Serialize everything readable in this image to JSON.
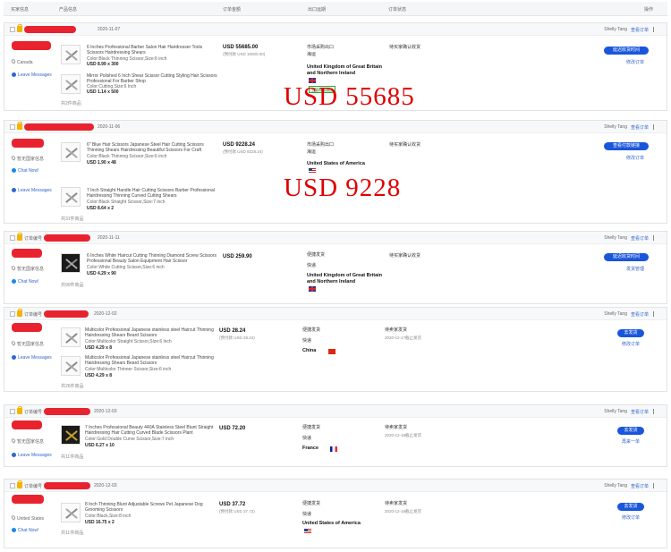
{
  "header": {
    "buyer": "买家信息",
    "product": "产品信息",
    "amount": "订单金额",
    "ship_date": "出口运期",
    "status": "订单状态",
    "action": "操作"
  },
  "orders": [
    {
      "date": "2020-11-07",
      "staff": "Shelly Tang",
      "remark": "查看订单",
      "country": "Canada",
      "message": "Leave Messages",
      "items": [
        {
          "title": "6 Inches Professional Barber Salon Hair Hairdresser Tools Scissors Hairdressing Shears",
          "meta": "Color:Black Thinning Scissor,Size:6 inch",
          "price": "USD 8.99 x 300"
        },
        {
          "title": "Mirror Polished 6 Inch Shear Scissor Cutting Styling Hair Scissors Professional For Barber Shop",
          "meta": "Color:Cutting,Size:6 Inch",
          "price": "USD 1.14 x 500"
        }
      ],
      "count": "共2件商品",
      "amount": "USD 55685.00",
      "amount_sub": "(预付款 USD 10000.00)",
      "shipping": [
        "市场采购出口",
        "海运"
      ],
      "destination": "United Kingdom of Great Britain and Northern Ireland",
      "flag": "uk",
      "status": "待买家确认收货",
      "button": "延迟收货时间",
      "link": "修改订单"
    },
    {
      "date": "2020-11-06",
      "staff": "Shelly Tang",
      "remark": "查看订单",
      "country": "暂无国家信息",
      "message": "Leave Messages",
      "chat": "Chat Now!",
      "items": [
        {
          "title": "6\" Blue Hair Scissors Japanese Steel Hair Cutting Scissors Thinning Shears Hairdressing Beautiful Scissors For Craft",
          "meta": "Color:Black Thinning Scissor,Size:6 inch",
          "price": "USD 1.90 x 48"
        },
        {
          "title": "7 Inch Straight Handle Hair Cutting Scissors Barber Professional Hairdressing Thinning Curved Cutting Shears",
          "meta": "Color:Black Straight Scissor,Size:7 inch",
          "price": "USD 8.64 x 2"
        }
      ],
      "count": "共31件商品",
      "amount": "USD 9228.24",
      "amount_sub": "(预付款 USD 9228.24)",
      "shipping": [
        "市场采购出口",
        "海运"
      ],
      "destination": "United States of America",
      "flag": "us",
      "status": "待买家确认收货",
      "button": "查看付款链接",
      "link": "修改订单"
    },
    {
      "label": "订单编号",
      "date": "2020-11-11",
      "staff": "Shelly Tang",
      "remark": "查看订单",
      "country": "暂无国家信息",
      "chat": "Chat Now!",
      "items": [
        {
          "title": "6 Inches White Haircut Cutting Thinning Diamond Screw Scissors Professional Beauty Salon Equipment Hair Scissor",
          "meta": "Color:White Cutting Scissor,Size:6 inch",
          "price": "USD 4.29 x 90"
        }
      ],
      "count": "共90件商品",
      "amount": "USD 259.90",
      "shipping": [
        "便捷发货",
        "快递"
      ],
      "destination": "United Kingdom of Great Britain and Northern Ireland",
      "flag": "uk",
      "status": "待买家确认收货",
      "button": "延迟收货时间",
      "link": "发货管理"
    },
    {
      "label": "订单编号",
      "date": "2020-12-02",
      "staff": "Shelly Tang",
      "remark": "查看订单",
      "country": "暂无国家信息",
      "message": "Leave Messages",
      "items": [
        {
          "title": "Multicolor Professional Japanese stainless steel Haircut Thinning Hairdressing Shears Beard Scissors",
          "meta": "Color:Multicolor Straight Scissor,Size:6 inch",
          "price": "USD 4.29 x 8"
        },
        {
          "title": "Multicolor Professional Japanese stainless steel Haircut Thinning Hairdressing Shears Beard Scissors",
          "meta": "Color:Multicolor Thinner Scissor,Size:6 inch",
          "price": "USD 4.29 x 8"
        }
      ],
      "count": "共26件商品",
      "amount": "USD 28.24",
      "amount_sub": "(预付款 USD 28.24)",
      "shipping": [
        "便捷发货",
        "快递"
      ],
      "destination": "China",
      "flag": "cn",
      "status": "待卖家发货",
      "status_sub": "2020-12-17截止发货",
      "button": "去发货",
      "link": "修改订单"
    },
    {
      "label": "订单编号",
      "date": "2020-12-03",
      "staff": "Shelly Tang",
      "remark": "查看订单",
      "country": "暂无国家信息",
      "message": "Leave Messages",
      "items": [
        {
          "title": "7 Inches Professional Beauty 440A Stainless Steel Blunt Straight Hairdressing Hair Cutting Curved Blade Scissors Plant",
          "meta": "Color:Gold Double Curve Scissor,Size:7 inch",
          "price": "USD 6.27 x 10"
        }
      ],
      "count": "共11件商品",
      "amount": "USD 72.20",
      "shipping": [
        "便捷发货",
        "快递"
      ],
      "destination": "France",
      "flag": "fr",
      "status": "待卖家发货",
      "status_sub": "2020-12-18截止发货",
      "button": "去发货",
      "link": "再来一单"
    },
    {
      "label": "订单编号",
      "date": "2020-12-03",
      "staff": "Shelly Tang",
      "remark": "查看订单",
      "country": "United States",
      "chat": "Chat Now!",
      "items": [
        {
          "title": "8 Inch Thinning Blunt Adjustable Screws Pet Japanese Dog Grooming Scissors",
          "meta": "Color:Black,Size:8 inch",
          "price": "USD 16.75 x 2"
        }
      ],
      "count": "共11件商品",
      "amount": "USD 37.72",
      "amount_sub": "(预付款 USD 37.72)",
      "shipping": [
        "便捷发货",
        "快递"
      ],
      "destination": "United States of America",
      "flag": "us",
      "status": "待卖家发货",
      "status_sub": "2020-12-18截止发货",
      "button": "去发货",
      "link": "修改订单"
    }
  ],
  "overlays": {
    "first": "USD 55685",
    "second": "USD 9228"
  },
  "badge": "主管审核通过"
}
